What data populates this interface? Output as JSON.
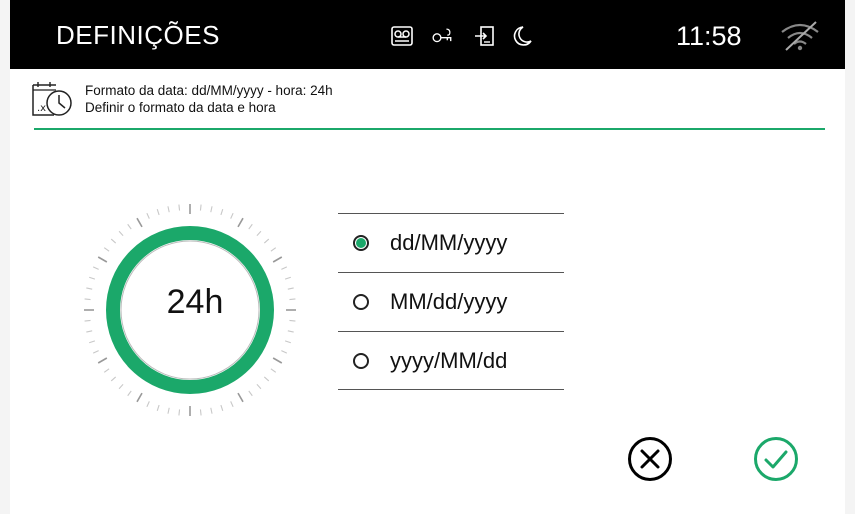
{
  "header": {
    "title": "DEFINIÇÕES",
    "time": "11:58",
    "status_icons": [
      "voicemail-icon",
      "key-icon",
      "door-entry-icon",
      "moon-icon",
      "wifi-off-icon"
    ]
  },
  "info": {
    "line1": "Formato da data: dd/MM/yyyy - hora: 24h",
    "line2": "Definir o formato da data e hora",
    "icon": "calendar-clock-icon"
  },
  "dial": {
    "label": "24h"
  },
  "date_formats": {
    "options": [
      "dd/MM/yyyy",
      "MM/dd/yyyy",
      "yyyy/MM/dd"
    ],
    "selected": "dd/MM/yyyy"
  },
  "actions": {
    "cancel": "cancel-icon",
    "confirm": "confirm-icon"
  },
  "colors": {
    "accent": "#1ba86a",
    "topbar": "#000000"
  }
}
